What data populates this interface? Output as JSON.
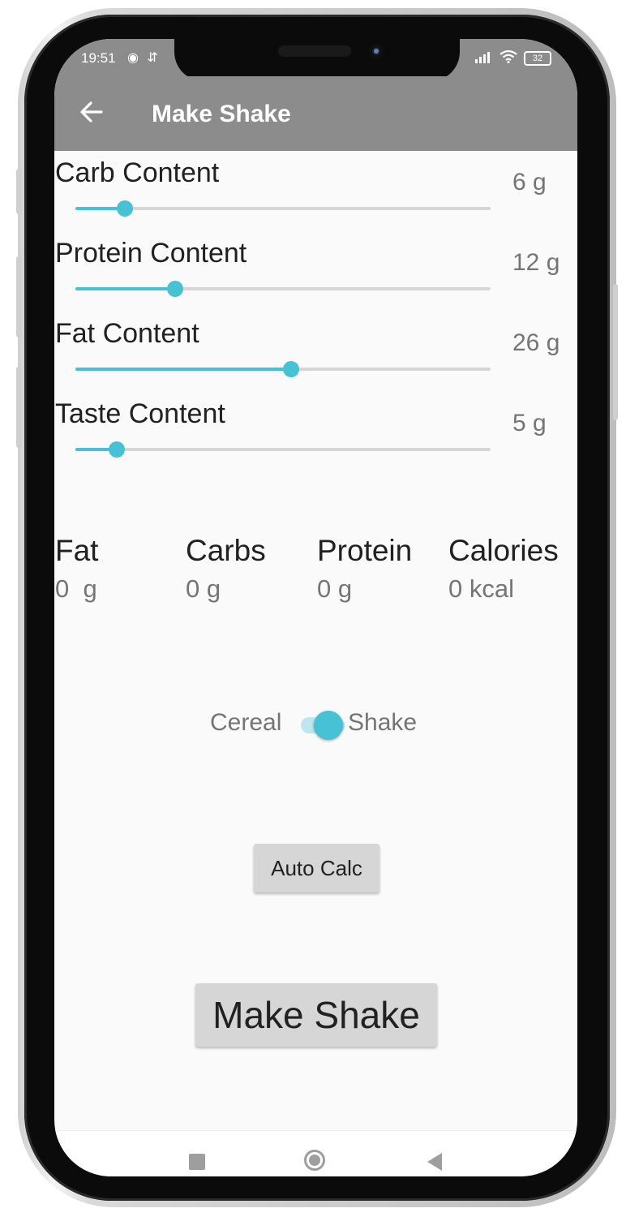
{
  "status_bar": {
    "time": "19:51",
    "battery": "32"
  },
  "app_bar": {
    "title": "Make Shake",
    "back_icon": "arrow-left-icon"
  },
  "sliders": [
    {
      "label": "Carb Content",
      "value_text": "6 g",
      "fraction": 0.12
    },
    {
      "label": "Protein Content",
      "value_text": "12 g",
      "fraction": 0.24
    },
    {
      "label": "Fat Content",
      "value_text": "26 g",
      "fraction": 0.52
    },
    {
      "label": "Taste Content",
      "value_text": "5 g",
      "fraction": 0.1
    }
  ],
  "nutrition": {
    "fat": {
      "label": "Fat",
      "value": "0  g"
    },
    "carbs": {
      "label": "Carbs",
      "value": "0 g"
    },
    "protein": {
      "label": "Protein",
      "value": "0 g"
    },
    "calories": {
      "label": "Calories",
      "value": "0 kcal"
    }
  },
  "toggle": {
    "left_label": "Cereal",
    "right_label": "Shake",
    "checked": true
  },
  "buttons": {
    "auto_calc": "Auto Calc",
    "make_shake": "Make Shake"
  },
  "colors": {
    "accent": "#47c2d4",
    "app_bar": "#8c8c8c",
    "button": "#d6d6d6"
  }
}
